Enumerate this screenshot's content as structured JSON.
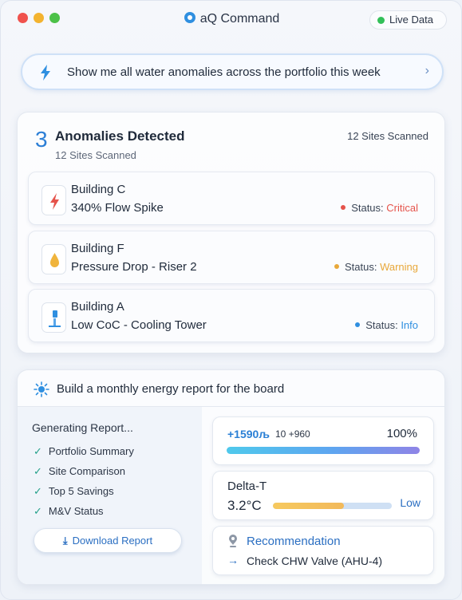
{
  "app": {
    "title": "aQ Command",
    "live_label": "Live Data"
  },
  "query": {
    "text": "Show me all water anomalies across the portfolio this week"
  },
  "anomalies": {
    "count": "3",
    "title": "Anomalies Detected",
    "subtitle": "12 Sites Scanned",
    "right_label": "12 Sites Scanned",
    "status_prefix": "Status: ",
    "items": [
      {
        "building": "Building C",
        "description": "340% Flow Spike",
        "status": "Critical",
        "color": "#e5534b",
        "icon": "bolt-icon"
      },
      {
        "building": "Building F",
        "description": "Pressure Drop - Riser 2",
        "status": "Warning",
        "color": "#e8a83a",
        "icon": "water-drop-icon"
      },
      {
        "building": "Building A",
        "description": "Low CoC - Cooling Tower",
        "status": "Info",
        "color": "#2f8fe0",
        "icon": "cooling-tower-icon"
      }
    ]
  },
  "report": {
    "title": "Build a monthly energy report for the board",
    "generating": "Generating Report...",
    "checklist": [
      "Portfolio Summary",
      "Site Comparison",
      "Top 5 Savings",
      "M&V Status"
    ],
    "download_label": "Download Report",
    "progress": {
      "primary": "+1590љ",
      "secondary": "10 +960",
      "percent_label": "100%",
      "percent": 100
    },
    "delta_t": {
      "label": "Delta-T",
      "value": "3.2°C",
      "level_label": "Low",
      "level": 0.6
    },
    "recommendation": {
      "label": "Recommendation",
      "text": "Check CHW Valve (AHU-4)"
    }
  },
  "colors": {
    "accent": "#2c7fd6",
    "critical": "#e5534b",
    "warning": "#e8a83a",
    "info": "#2f8fe0",
    "success": "#24a08a"
  }
}
